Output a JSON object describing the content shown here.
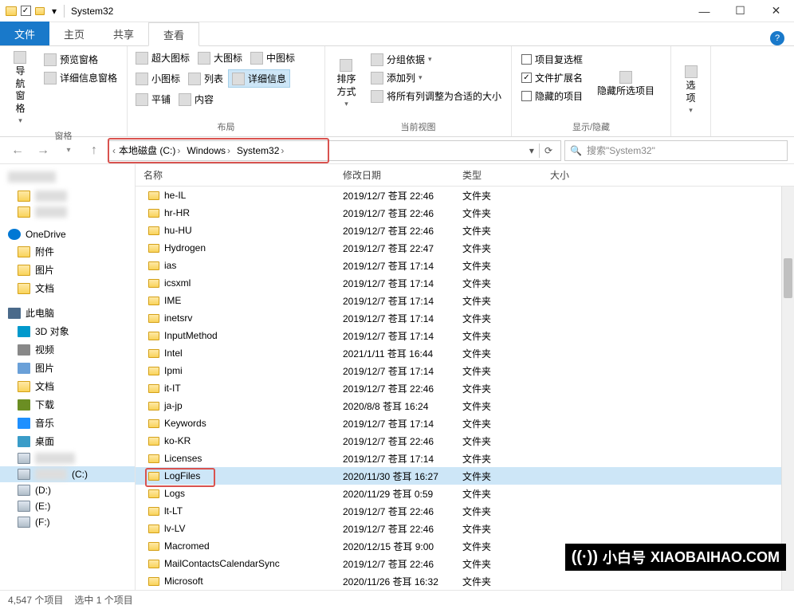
{
  "window": {
    "title": "System32"
  },
  "tabs": {
    "file": "文件",
    "home": "主页",
    "share": "共享",
    "view": "查看"
  },
  "ribbon": {
    "panes": {
      "nav_pane": "导航窗格",
      "preview_pane": "预览窗格",
      "details_pane": "详细信息窗格",
      "label": "窗格"
    },
    "layout": {
      "extra_large": "超大图标",
      "large": "大图标",
      "medium": "中图标",
      "small": "小图标",
      "list": "列表",
      "details": "详细信息",
      "tiles": "平铺",
      "content": "内容",
      "label": "布局"
    },
    "current_view": {
      "sort": "排序方式",
      "group": "分组依据",
      "add_columns": "添加列",
      "fit_columns": "将所有列调整为合适的大小",
      "label": "当前视图"
    },
    "show_hide": {
      "item_checkboxes": "项目复选框",
      "file_extensions": "文件扩展名",
      "hidden_items": "隐藏的项目",
      "hide_selected": "隐藏所选项目",
      "label": "显示/隐藏"
    },
    "options": "选项"
  },
  "address": {
    "segments": [
      "本地磁盘 (C:)",
      "Windows",
      "System32"
    ]
  },
  "search": {
    "placeholder": "搜索\"System32\""
  },
  "columns": {
    "name": "名称",
    "date": "修改日期",
    "type": "类型",
    "size": "大小"
  },
  "files": [
    {
      "name": "he-IL",
      "date": "2019/12/7 苍耳 22:46",
      "type": "文件夹"
    },
    {
      "name": "hr-HR",
      "date": "2019/12/7 苍耳 22:46",
      "type": "文件夹"
    },
    {
      "name": "hu-HU",
      "date": "2019/12/7 苍耳 22:46",
      "type": "文件夹"
    },
    {
      "name": "Hydrogen",
      "date": "2019/12/7 苍耳 22:47",
      "type": "文件夹"
    },
    {
      "name": "ias",
      "date": "2019/12/7 苍耳 17:14",
      "type": "文件夹"
    },
    {
      "name": "icsxml",
      "date": "2019/12/7 苍耳 17:14",
      "type": "文件夹"
    },
    {
      "name": "IME",
      "date": "2019/12/7 苍耳 17:14",
      "type": "文件夹"
    },
    {
      "name": "inetsrv",
      "date": "2019/12/7 苍耳 17:14",
      "type": "文件夹"
    },
    {
      "name": "InputMethod",
      "date": "2019/12/7 苍耳 17:14",
      "type": "文件夹"
    },
    {
      "name": "Intel",
      "date": "2021/1/11 苍耳 16:44",
      "type": "文件夹"
    },
    {
      "name": "Ipmi",
      "date": "2019/12/7 苍耳 17:14",
      "type": "文件夹"
    },
    {
      "name": "it-IT",
      "date": "2019/12/7 苍耳 22:46",
      "type": "文件夹"
    },
    {
      "name": "ja-jp",
      "date": "2020/8/8 苍耳 16:24",
      "type": "文件夹"
    },
    {
      "name": "Keywords",
      "date": "2019/12/7 苍耳 17:14",
      "type": "文件夹"
    },
    {
      "name": "ko-KR",
      "date": "2019/12/7 苍耳 22:46",
      "type": "文件夹"
    },
    {
      "name": "Licenses",
      "date": "2019/12/7 苍耳 17:14",
      "type": "文件夹"
    },
    {
      "name": "LogFiles",
      "date": "2020/11/30 苍耳 16:27",
      "type": "文件夹",
      "selected": true,
      "highlighted": true
    },
    {
      "name": "Logs",
      "date": "2020/11/29 苍耳 0:59",
      "type": "文件夹"
    },
    {
      "name": "lt-LT",
      "date": "2019/12/7 苍耳 22:46",
      "type": "文件夹"
    },
    {
      "name": "lv-LV",
      "date": "2019/12/7 苍耳 22:46",
      "type": "文件夹"
    },
    {
      "name": "Macromed",
      "date": "2020/12/15 苍耳 9:00",
      "type": "文件夹"
    },
    {
      "name": "MailContactsCalendarSync",
      "date": "2019/12/7 苍耳 22:46",
      "type": "文件夹"
    },
    {
      "name": "Microsoft",
      "date": "2020/11/26 苍耳 16:32",
      "type": "文件夹"
    }
  ],
  "sidebar": {
    "onedrive": "OneDrive",
    "attachments": "附件",
    "pictures": "图片",
    "documents": "文档",
    "this_pc": "此电脑",
    "objects_3d": "3D 对象",
    "videos": "视频",
    "pictures2": "图片",
    "documents2": "文档",
    "downloads": "下载",
    "music": "音乐",
    "desktop": "桌面",
    "drive_c": "(C:)",
    "drive_d": "(D:)",
    "drive_e": "(E:)",
    "drive_f": "(F:)"
  },
  "status": {
    "items": "4,547 个项目",
    "selected": "选中 1 个项目"
  },
  "watermark": {
    "cn": "小白号",
    "en": "XIAOBAIHAO.COM"
  }
}
